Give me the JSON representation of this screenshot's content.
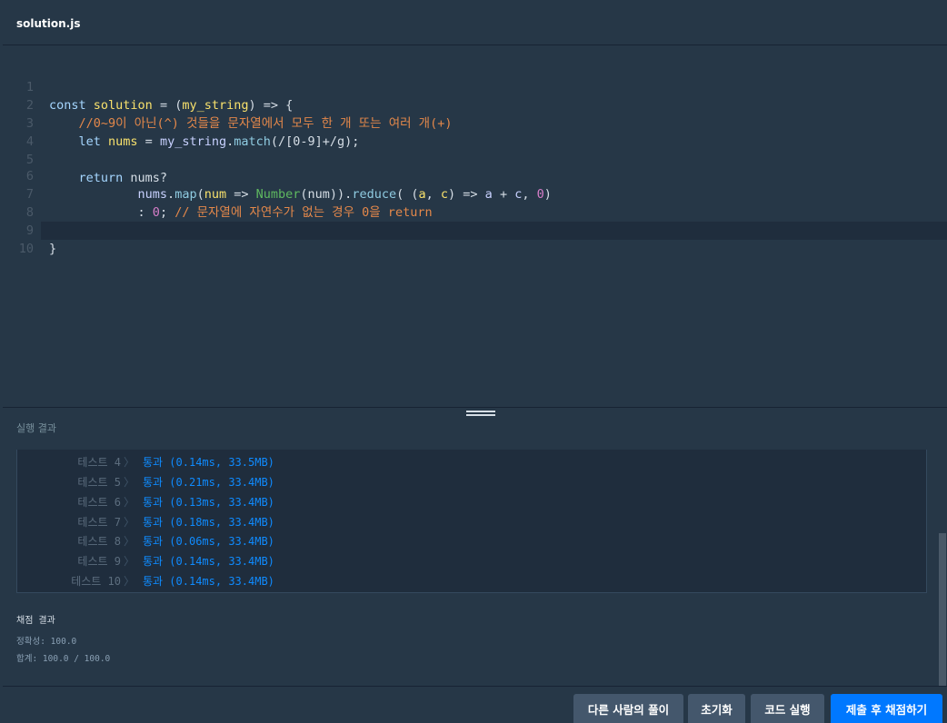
{
  "file_tab": "solution.js",
  "code_lines": [
    {
      "n": "1"
    },
    {
      "n": "2"
    },
    {
      "n": "3"
    },
    {
      "n": "4"
    },
    {
      "n": "5"
    },
    {
      "n": "6"
    },
    {
      "n": "7"
    },
    {
      "n": "8"
    },
    {
      "n": "9"
    },
    {
      "n": "10"
    }
  ],
  "code": {
    "l1_const": "const ",
    "l1_name": "solution",
    "l1_rest": " = (",
    "l1_param": "my_string",
    "l1_end": ") => {",
    "l2": "    //0~9이 아닌(^) 것들을 문자열에서 모두 한 개 또는 여러 개(+)",
    "l3_let": "    let ",
    "l3_var": "nums",
    "l3_eq": " = ",
    "l3_obj": "my_string",
    "l3_dot": ".",
    "l3_method": "match",
    "l3_rest": "(/[0-9]+/g);",
    "l5_ret": "    return ",
    "l5_rest": "nums?",
    "l6_obj": "            nums",
    "l6_dot": ".",
    "l6_map": "map",
    "l6_p1": "(",
    "l6_num": "num",
    "l6_arrow": " => ",
    "l6_Number": "Number",
    "l6_p2": "(num)).",
    "l6_reduce": "reduce",
    "l6_p3": "( (",
    "l6_a": "a",
    "l6_comma": ", ",
    "l6_c": "c",
    "l6_arrow2": ") => ",
    "l6_a2": "a",
    "l6_plus": " + ",
    "l6_c2": "c",
    "l6_comma2": ", ",
    "l6_zero": "0",
    "l6_close": ")",
    "l7_colon": "            : ",
    "l7_zero": "0",
    "l7_semi": "; ",
    "l7_comment": "// 문자열에 자연수가 없는 경우 0을 return",
    "l9": "}"
  },
  "result_title": "실행 결과",
  "tests": [
    {
      "name": "테스트 4",
      "status": "통과 (0.14ms, 33.5MB)"
    },
    {
      "name": "테스트 5",
      "status": "통과 (0.21ms, 33.4MB)"
    },
    {
      "name": "테스트 6",
      "status": "통과 (0.13ms, 33.4MB)"
    },
    {
      "name": "테스트 7",
      "status": "통과 (0.18ms, 33.4MB)"
    },
    {
      "name": "테스트 8",
      "status": "통과 (0.06ms, 33.4MB)"
    },
    {
      "name": "테스트 9",
      "status": "통과 (0.14ms, 33.4MB)"
    },
    {
      "name": "테스트 10",
      "status": "통과 (0.14ms, 33.4MB)"
    }
  ],
  "test_separator": "〉",
  "score": {
    "title": "채점 결과",
    "accuracy": "정확성: 100.0",
    "total": "합계: 100.0 / 100.0"
  },
  "buttons": {
    "others": "다른 사람의 풀이",
    "reset": "초기화",
    "run": "코드 실행",
    "submit": "제출 후 채점하기"
  },
  "colors": {
    "primary": "#0078ff",
    "background": "#263747",
    "pass": "#0f8bff"
  }
}
